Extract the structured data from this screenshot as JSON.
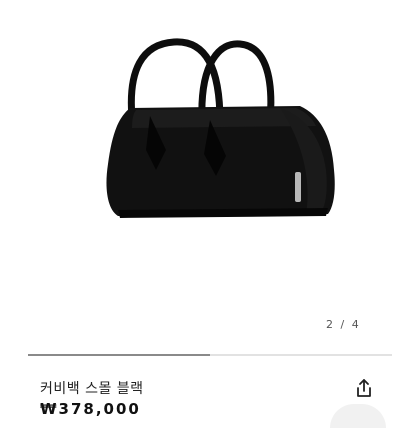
{
  "gallery": {
    "pager": "2 / 4",
    "progress": 0.5
  },
  "product": {
    "name": "커비백 스몰 블랙",
    "price": "₩378,000",
    "color": "#0d0d0d"
  },
  "icons": {
    "share": "share-icon"
  }
}
